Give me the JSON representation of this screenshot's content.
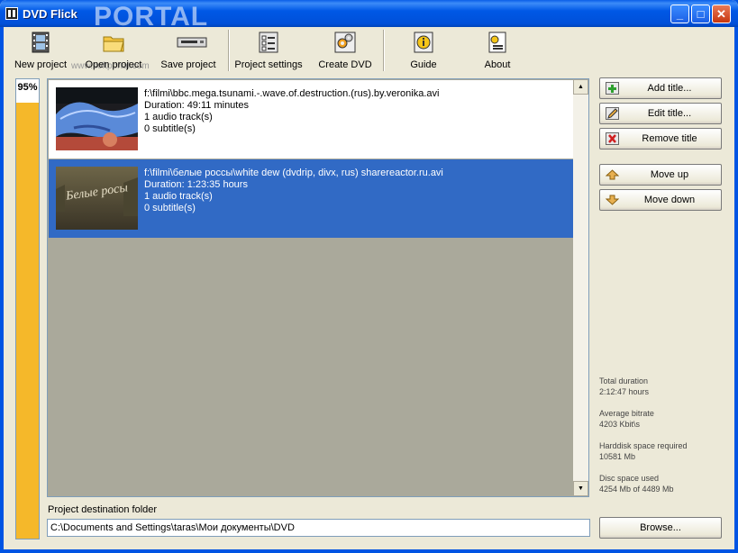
{
  "window": {
    "title": "DVD Flick",
    "watermark": "PORTAL",
    "watermark_sub": "www.softportal.com",
    "controls": {
      "minimize": "_",
      "maximize": "□",
      "close": "✕"
    }
  },
  "toolbar": {
    "items": [
      {
        "label": "New project",
        "icon": "film-strip-icon"
      },
      {
        "label": "Open project",
        "icon": "folder-open-icon"
      },
      {
        "label": "Save project",
        "icon": "disk-drive-icon"
      },
      {
        "label": "Project settings",
        "icon": "settings-panel-icon"
      },
      {
        "label": "Create DVD",
        "icon": "gears-icon"
      },
      {
        "label": "Guide",
        "icon": "info-book-icon"
      },
      {
        "label": "About",
        "icon": "about-document-icon"
      }
    ]
  },
  "progress": {
    "label": "95%",
    "fill": 0.95
  },
  "titles": [
    {
      "path": "f:\\filmi\\bbc.mega.tsunami.-.wave.of.destruction.(rus).by.veronika.avi",
      "duration": "Duration: 49:11 minutes",
      "audio": "1 audio track(s)",
      "subtitles": "0 subtitle(s)",
      "selected": false
    },
    {
      "path": "f:\\filmi\\белые россы\\white dew (dvdrip, divx, rus) sharereactor.ru.avi",
      "duration": "Duration: 1:23:35 hours",
      "audio": "1 audio track(s)",
      "subtitles": "0 subtitle(s)",
      "selected": true,
      "thumb_text": "Белые росы"
    }
  ],
  "side_buttons": {
    "add": "Add title...",
    "edit": "Edit title...",
    "remove": "Remove title",
    "up": "Move up",
    "down": "Move down"
  },
  "stats": {
    "total_duration_label": "Total duration",
    "total_duration": "2:12:47 hours",
    "bitrate_label": "Average bitrate",
    "bitrate": "4203 Kbit\\s",
    "harddisk_label": "Harddisk space required",
    "harddisk": "10581 Mb",
    "disc_label": "Disc space used",
    "disc": "4254 Mb of 4489 Mb"
  },
  "destination": {
    "label": "Project destination folder",
    "value": "C:\\Documents and Settings\\taras\\Мои документы\\DVD",
    "browse": "Browse..."
  },
  "colors": {
    "selection": "#316ac5",
    "progress": "#f5b82a",
    "titlebar": "#0058e6"
  }
}
